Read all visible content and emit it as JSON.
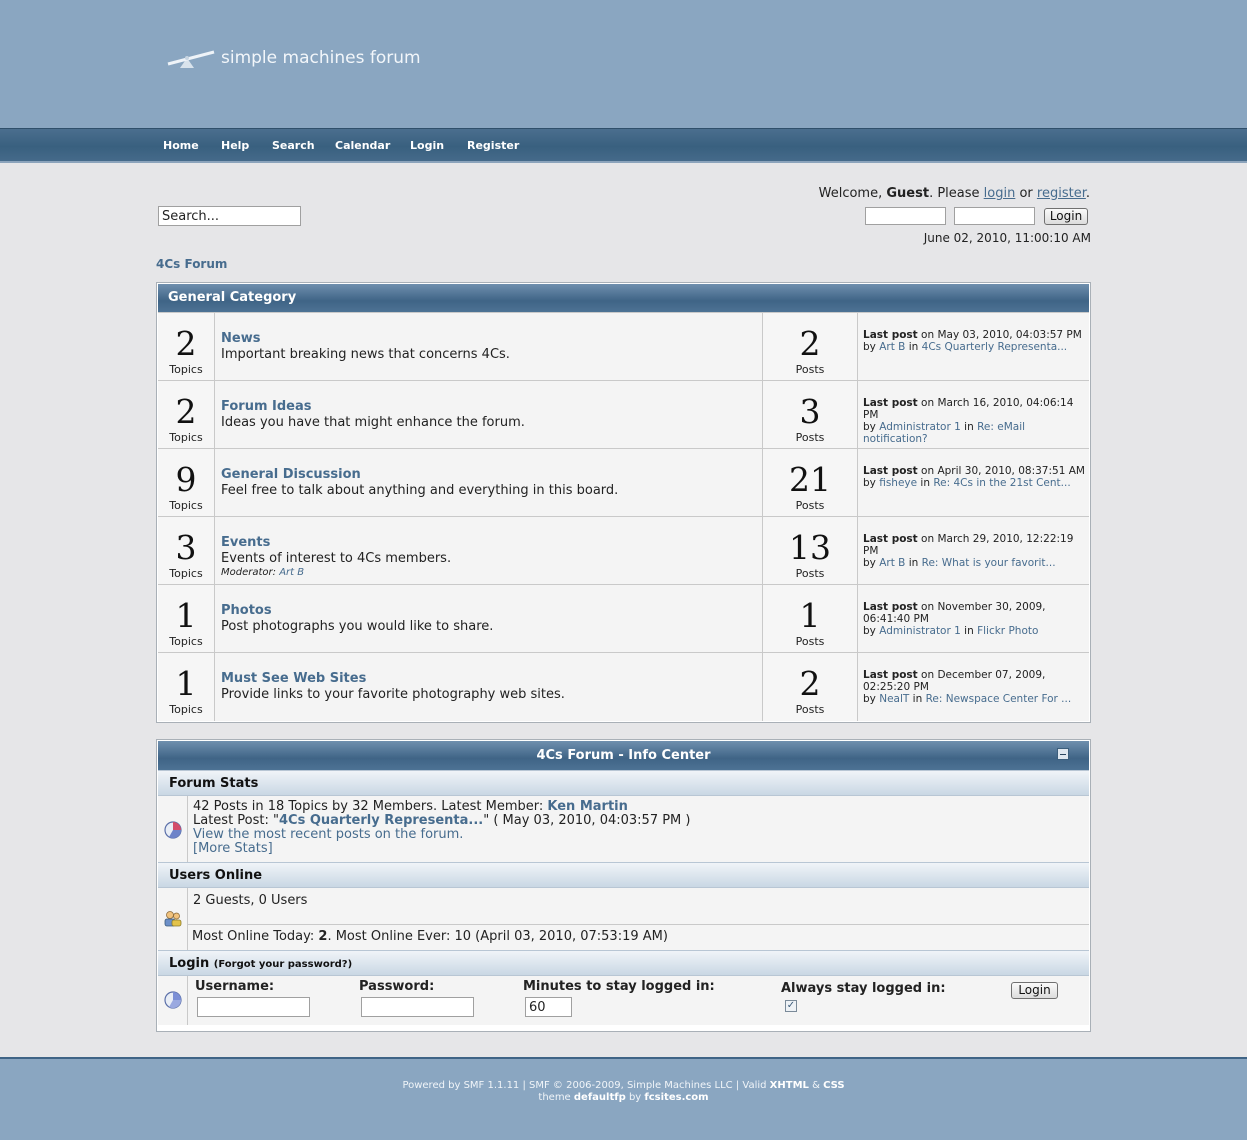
{
  "logo": {
    "text": "simple machines forum"
  },
  "nav": {
    "items": [
      "Home",
      "Help",
      "Search",
      "Calendar",
      "Login",
      "Register"
    ]
  },
  "user": {
    "welcome_prefix": "Welcome, ",
    "guest": "Guest",
    "please": ". Please ",
    "login_link": "login",
    "or": " or ",
    "register_link": "register",
    "end": ".",
    "login_button": "Login",
    "date": "June 02, 2010, 11:00:10 AM"
  },
  "search": {
    "placeholder": "Search..."
  },
  "linktree": {
    "forum": "4Cs Forum"
  },
  "category": {
    "title": "General Category",
    "boards": [
      {
        "topics": "2",
        "topics_label": "Topics",
        "name": "News",
        "desc": "Important breaking news that concerns 4Cs.",
        "moderator_label": "",
        "moderator": "",
        "posts": "2",
        "posts_label": "Posts",
        "last_label": "Last post",
        "last_on": " on May 03, 2010, 04:03:57 PM",
        "by": "by ",
        "by_user": "Art B",
        "in": " in ",
        "topic": "4Cs Quarterly Representa..."
      },
      {
        "topics": "2",
        "topics_label": "Topics",
        "name": "Forum Ideas",
        "desc": "Ideas you have that might enhance the forum.",
        "moderator_label": "",
        "moderator": "",
        "posts": "3",
        "posts_label": "Posts",
        "last_label": "Last post",
        "last_on": " on March 16, 2010, 04:06:14 PM",
        "by": "by ",
        "by_user": "Administrator 1",
        "in": " in ",
        "topic": "Re: eMail notification?"
      },
      {
        "topics": "9",
        "topics_label": "Topics",
        "name": "General Discussion",
        "desc": "Feel free to talk about anything and everything in this board.",
        "moderator_label": "",
        "moderator": "",
        "posts": "21",
        "posts_label": "Posts",
        "last_label": "Last post",
        "last_on": " on April 30, 2010, 08:37:51 AM",
        "by": "by ",
        "by_user": "fisheye",
        "in": " in ",
        "topic": "Re: 4Cs in the 21st Cent..."
      },
      {
        "topics": "3",
        "topics_label": "Topics",
        "name": "Events",
        "desc": "Events of interest to 4Cs members.",
        "moderator_label": "Moderator: ",
        "moderator": "Art B",
        "posts": "13",
        "posts_label": "Posts",
        "last_label": "Last post",
        "last_on": " on March 29, 2010, 12:22:19 PM",
        "by": "by ",
        "by_user": "Art B",
        "in": " in ",
        "topic": "Re: What is your favorit..."
      },
      {
        "topics": "1",
        "topics_label": "Topics",
        "name": "Photos",
        "desc": "Post photographs you would like to share.",
        "moderator_label": "",
        "moderator": "",
        "posts": "1",
        "posts_label": "Posts",
        "last_label": "Last post",
        "last_on": " on November 30, 2009, 06:41:40 PM",
        "by": "by ",
        "by_user": "Administrator 1",
        "in": " in ",
        "topic": "Flickr Photo"
      },
      {
        "topics": "1",
        "topics_label": "Topics",
        "name": "Must See Web Sites",
        "desc": "Provide links to your favorite photography web sites.",
        "moderator_label": "",
        "moderator": "",
        "posts": "2",
        "posts_label": "Posts",
        "last_label": "Last post",
        "last_on": " on December 07, 2009, 02:25:20 PM",
        "by": "by ",
        "by_user": "NealT",
        "in": " in ",
        "topic": "Re: Newspace Center For ..."
      }
    ]
  },
  "info_center": {
    "title": "4Cs Forum - Info Center",
    "stats_title": "Forum Stats",
    "stats_line1": "42 Posts in 18 Topics by 32 Members. Latest Member: ",
    "latest_member": "Ken Martin",
    "latest_post_prefix": "Latest Post: \"",
    "latest_post": "4Cs Quarterly Representa...",
    "latest_post_suffix": "\" ( May 03, 2010, 04:03:57 PM )",
    "recent_link": "View the most recent posts on the forum.",
    "more_stats": "[More Stats]",
    "users_title": "Users Online",
    "users_line": "2 Guests, 0 Users",
    "most_online_prefix": "Most Online Today: ",
    "most_online_today": "2",
    "most_online_suffix": ". Most Online Ever: 10 (April 03, 2010, 07:53:19 AM)",
    "login_title": "Login",
    "forgot": "(Forgot your password?)",
    "username_label": "Username:",
    "password_label": "Password:",
    "minutes_label": "Minutes to stay logged in:",
    "minutes_value": "60",
    "always_label": "Always stay logged in:",
    "always_checked": true,
    "login_button": "Login"
  },
  "footer": {
    "powered": "Powered by SMF 1.1.11 | SMF © 2006-2009, Simple Machines LLC | Valid ",
    "xhtml": "XHTML",
    "amp": " & ",
    "css": "CSS",
    "theme_prefix": "theme ",
    "theme_name": "defaultfp",
    "by": " by ",
    "site": "fcsites.com"
  },
  "colors": {
    "header_bg": "#8aa6c1",
    "navbar_bg": "#39607f",
    "link": "#476c8e",
    "page_bg": "#e6e6e8"
  }
}
